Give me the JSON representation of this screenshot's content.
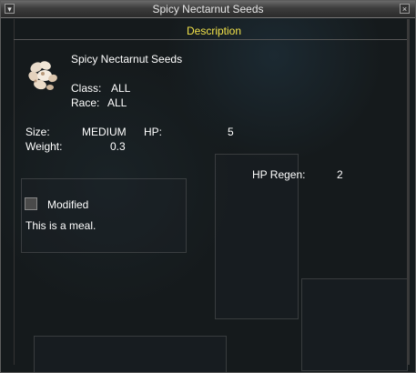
{
  "window": {
    "title": "Spicy Nectarnut Seeds",
    "minimize_glyph": "▾",
    "close_glyph": "×"
  },
  "description": {
    "header": "Description",
    "item_name": "Spicy Nectarnut Seeds",
    "class_label": "Class:",
    "class_value": "ALL",
    "race_label": "Race:",
    "race_value": "ALL",
    "size_label": "Size:",
    "size_value": "MEDIUM",
    "hp_label": "HP:",
    "hp_value": "5",
    "weight_label": "Weight:",
    "weight_value": "0.3",
    "hp_regen_label": "HP Regen:",
    "hp_regen_value": "2",
    "modified_label": "Modified",
    "modified_checked": false,
    "flavor_text": "This is a meal."
  },
  "icons": {
    "item": "seeds-icon"
  },
  "colors": {
    "header_text": "#f2e24a",
    "body_text": "#ffffff",
    "window_bg": "#1a1e20"
  }
}
